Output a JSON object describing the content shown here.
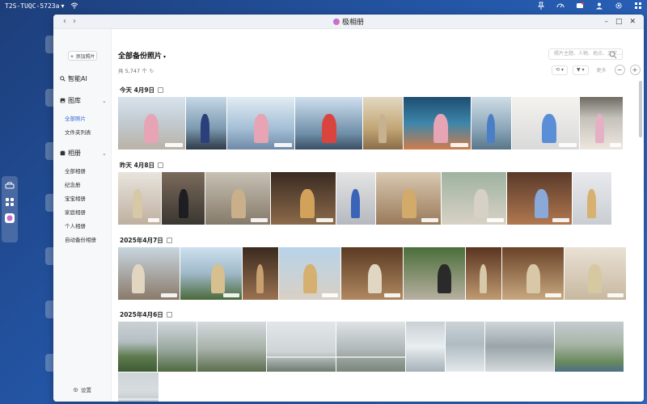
{
  "desktop": {
    "hostname": "T2S-TUQC-5723a",
    "host_caret": "▾"
  },
  "app": {
    "title": "极相册",
    "nav_back": "‹",
    "nav_forward": "›",
    "win_minimize": "–",
    "win_maximize": "□",
    "win_close": "✕"
  },
  "sidebar": {
    "add_photos_label": "+ 添加照片",
    "ai_section": "智能AI",
    "gallery_section": "图库",
    "gallery_items": [
      "全部照片",
      "文件夹列表"
    ],
    "albums_section": "相册",
    "album_items": [
      "全部相册",
      "纪念册",
      "宝宝相册",
      "家庭相册",
      "个人相册",
      "自动备份相册"
    ],
    "settings_label": "设置"
  },
  "main": {
    "title": "全部备份照片",
    "title_caret": "▾",
    "count": "共 5,747 个",
    "refresh_icon": "↻",
    "search_placeholder": "照片主题、人物、地点、文字...",
    "view_label": "⟲ ▾",
    "filter_label": "▼ ▾",
    "more_label": "更多",
    "zoom_out": "−",
    "zoom_in": "+"
  },
  "groups": [
    {
      "date": "今天  4月9日"
    },
    {
      "date": "昨天  4月8日"
    },
    {
      "date": "2025年4月7日"
    },
    {
      "date": "2025年4月6日"
    }
  ],
  "colors": {
    "accent": "#2f6ad6",
    "desktop_bg": "#2457a8",
    "window_bg": "#ffffff",
    "sidebar_bg": "#f7f8fa"
  }
}
